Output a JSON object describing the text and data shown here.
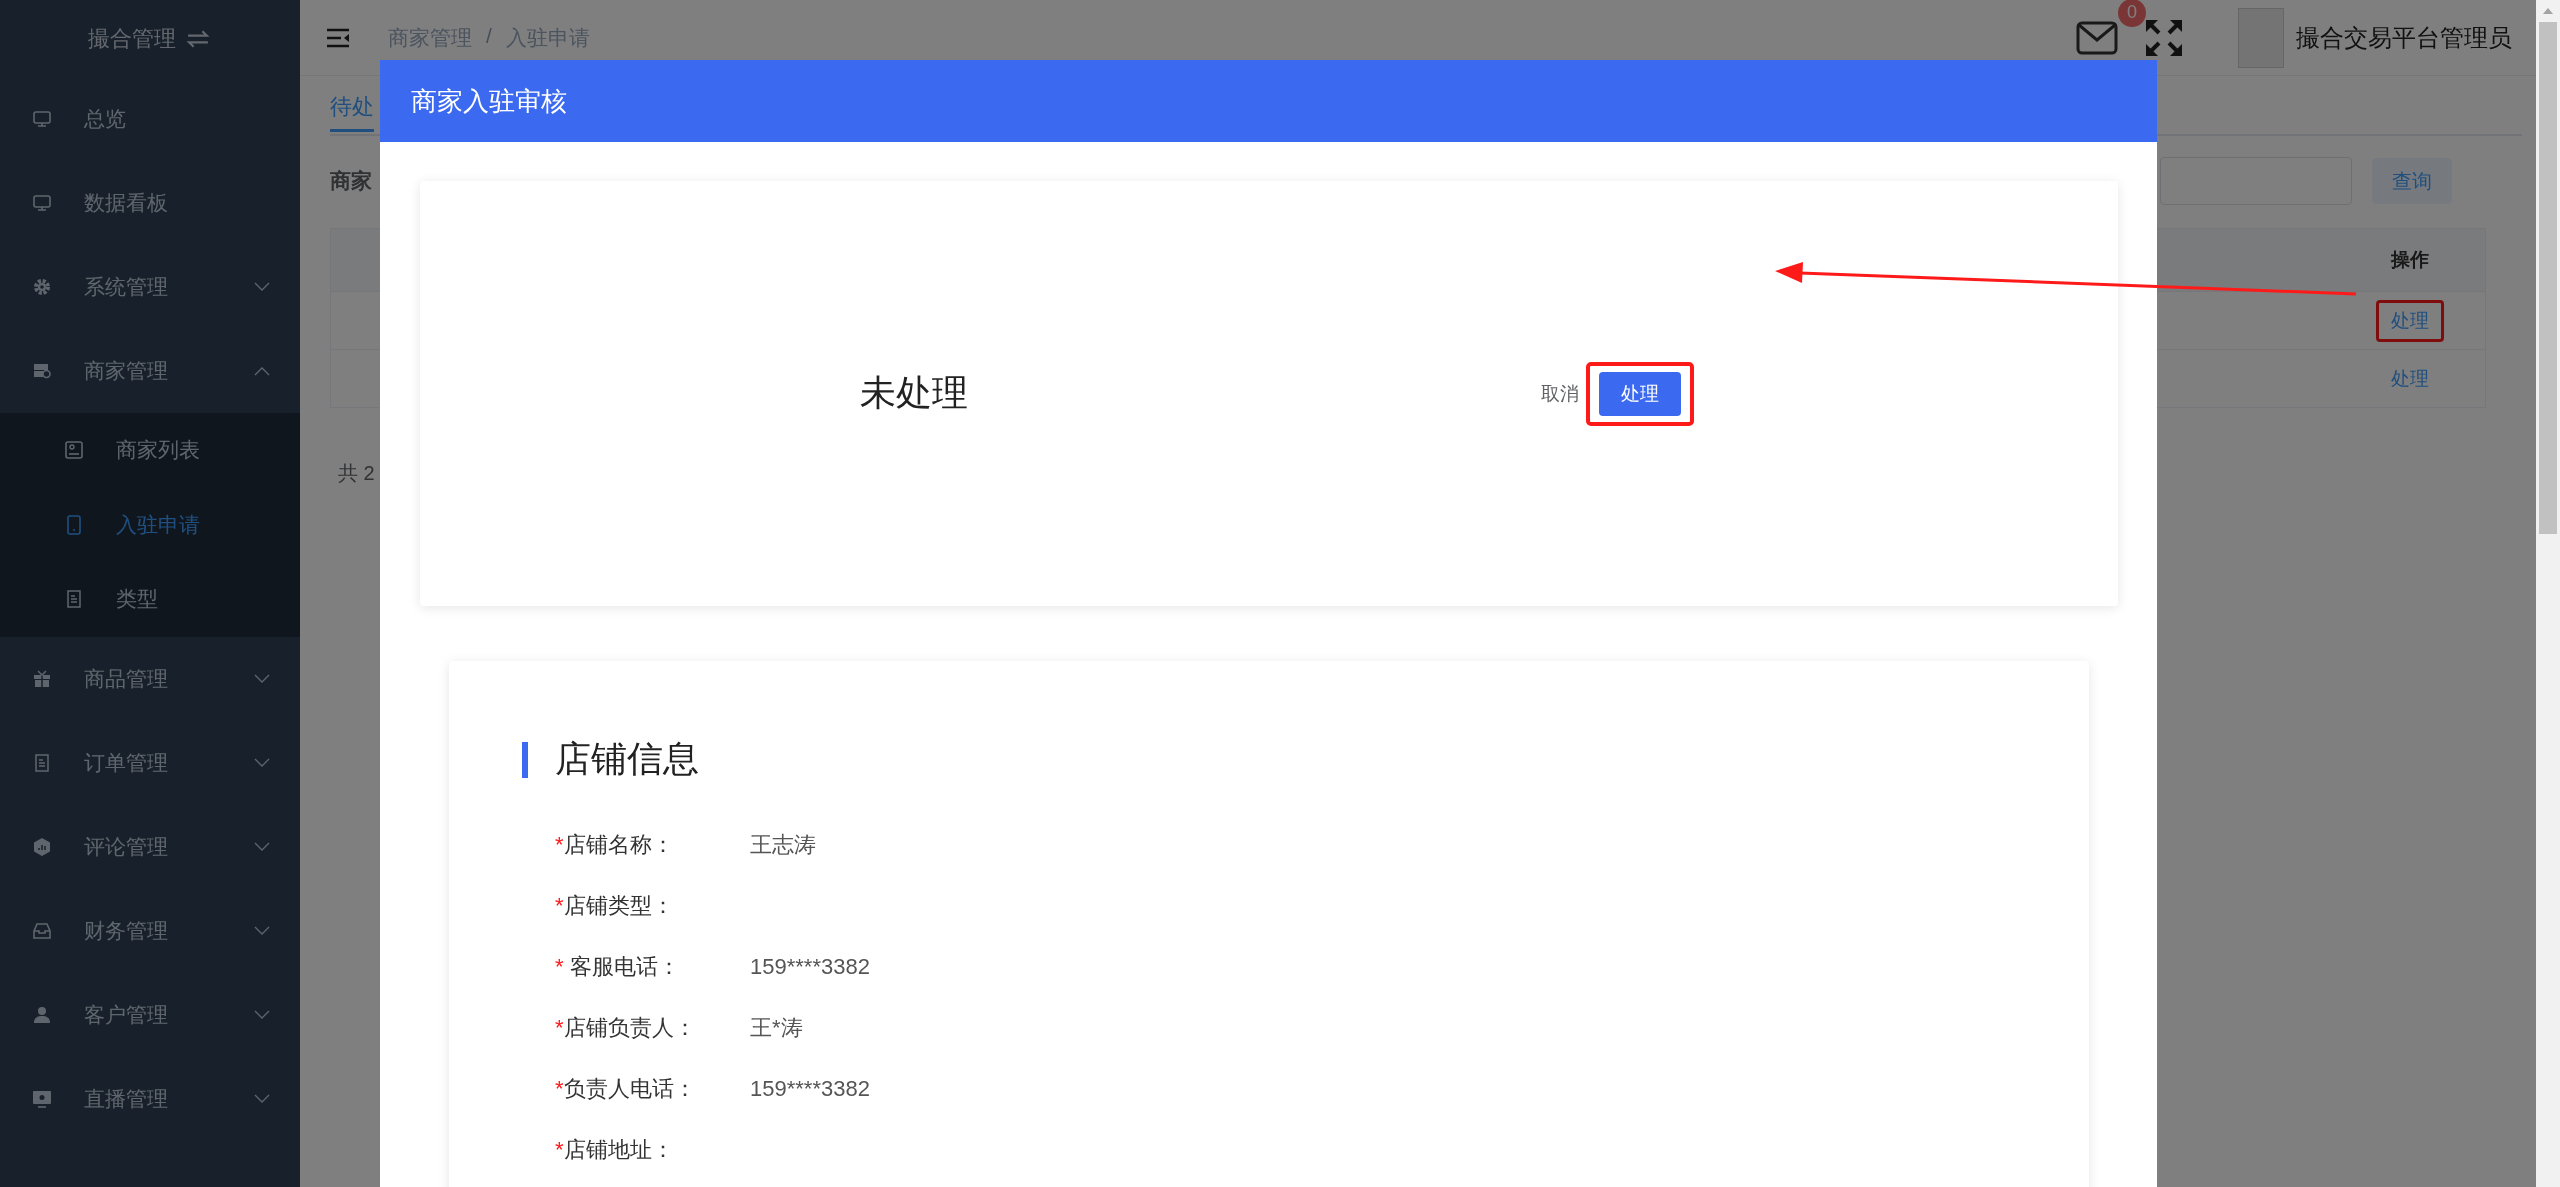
{
  "sidebar": {
    "title": "撮合管理",
    "items": [
      {
        "label": "总览",
        "selected": false
      },
      {
        "label": "数据看板",
        "selected": false
      },
      {
        "label": "系统管理",
        "selected": false,
        "expanded": false
      },
      {
        "label": "商家管理",
        "selected": false,
        "expanded": true,
        "children": [
          {
            "label": "商家列表",
            "selected": false
          },
          {
            "label": "入驻申请",
            "selected": true
          },
          {
            "label": "类型",
            "selected": false
          }
        ]
      },
      {
        "label": "商品管理",
        "selected": false,
        "expanded": false
      },
      {
        "label": "订单管理",
        "selected": false,
        "expanded": false
      },
      {
        "label": "评论管理",
        "selected": false,
        "expanded": false
      },
      {
        "label": "财务管理",
        "selected": false,
        "expanded": false
      },
      {
        "label": "客户管理",
        "selected": false,
        "expanded": false
      },
      {
        "label": "直播管理",
        "selected": false,
        "expanded": false
      }
    ]
  },
  "header": {
    "breadcrumb": [
      "商家管理",
      "入驻申请"
    ],
    "breadcrumb_separator": "/",
    "message_count": "0",
    "user_name": "撮合交易平台管理员"
  },
  "page": {
    "tabs": [
      {
        "label": "待处",
        "selected": true
      }
    ],
    "filter_label": "商家",
    "search_button": "查询",
    "table": {
      "columns": [
        "操作"
      ],
      "rows": [
        {
          "action": "处理",
          "highlighted": true
        },
        {
          "action": "处理",
          "highlighted": false
        }
      ]
    },
    "total": "共 2"
  },
  "modal": {
    "title": "商家入驻审核",
    "status": "未处理",
    "cancel": "取消",
    "submit": "处理",
    "submit_highlighted": true,
    "section": {
      "title": "店铺信息",
      "fields": [
        {
          "mark": "*",
          "label": "店铺名称：",
          "value": "王志涛"
        },
        {
          "mark": "*",
          "label": "店铺类型："
        },
        {
          "mark": "*",
          "label": " 客服电话：",
          "value": "159****3382"
        },
        {
          "mark": "*",
          "label": "店铺负责人：",
          "value": "王*涛"
        },
        {
          "mark": "*",
          "label": "负责人电话：",
          "value": "159****3382"
        },
        {
          "mark": "*",
          "label": "店铺地址："
        }
      ]
    }
  }
}
